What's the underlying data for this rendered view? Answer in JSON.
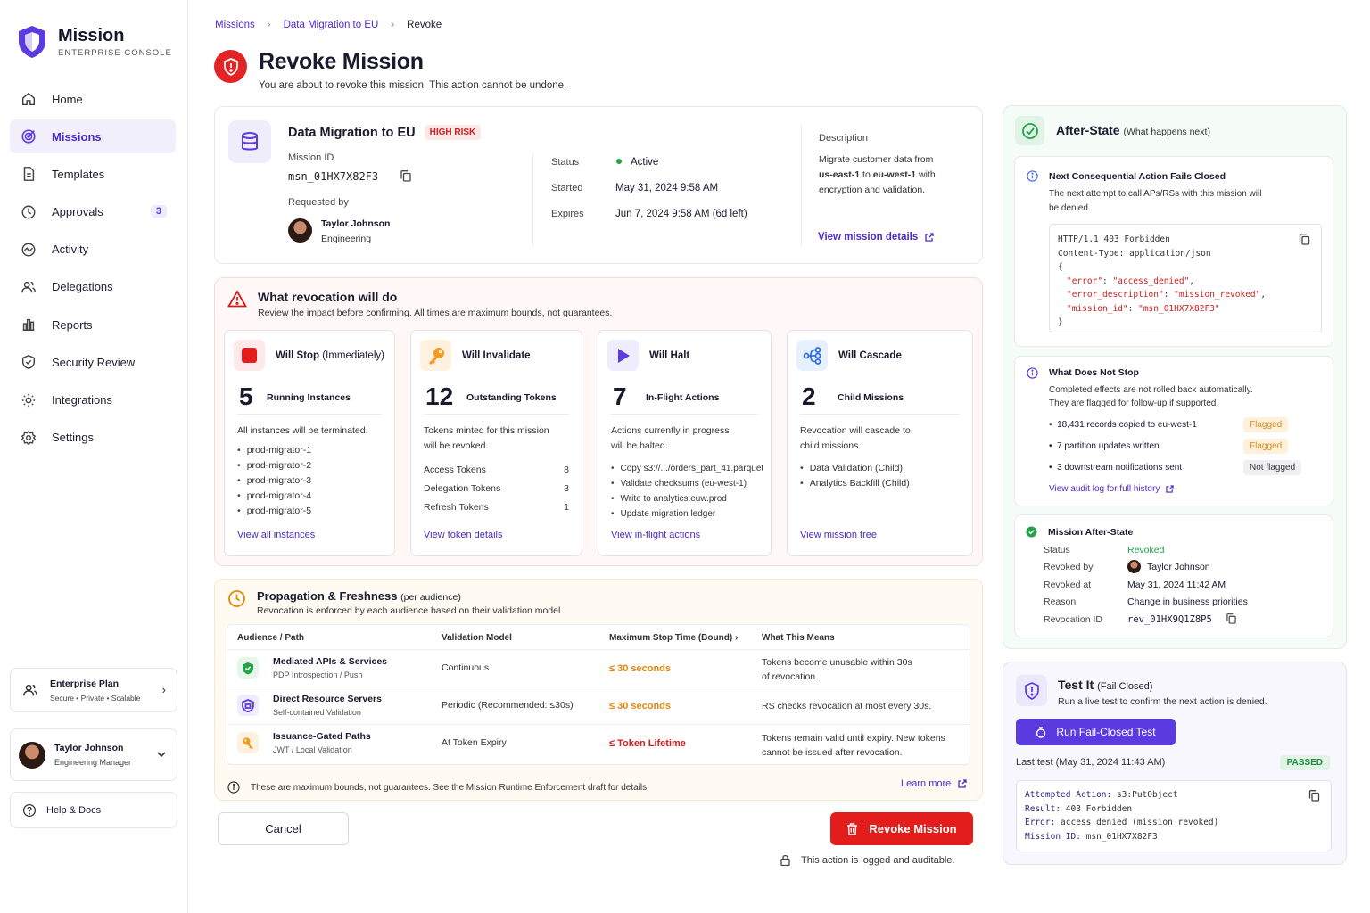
{
  "brand": {
    "name": "Mission",
    "subtitle": "ENTERPRISE CONSOLE"
  },
  "nav": [
    {
      "label": "Home",
      "icon": "home-icon"
    },
    {
      "label": "Missions",
      "icon": "target-icon",
      "active": true
    },
    {
      "label": "Templates",
      "icon": "document-icon"
    },
    {
      "label": "Approvals",
      "icon": "clock-icon",
      "badge": "3"
    },
    {
      "label": "Activity",
      "icon": "activity-icon"
    },
    {
      "label": "Delegations",
      "icon": "users-icon"
    },
    {
      "label": "Reports",
      "icon": "bar-chart-icon"
    },
    {
      "label": "Security Review",
      "icon": "shield-check-icon"
    },
    {
      "label": "Integrations",
      "icon": "cog-icon"
    },
    {
      "label": "Settings",
      "icon": "gear-icon"
    }
  ],
  "plan": {
    "title": "Enterprise Plan",
    "sub": "Secure • Private • Scalable"
  },
  "user": {
    "name": "Taylor Johnson",
    "role": "Engineering Manager"
  },
  "help": "Help & Docs",
  "breadcrumb": [
    "Missions",
    "Data Migration to EU",
    "Revoke"
  ],
  "page": {
    "title": "Revoke Mission",
    "subtitle": "You are about to revoke this mission. This action cannot be undone."
  },
  "mission": {
    "name": "Data Migration to EU",
    "risk": "HIGH RISK",
    "id_label": "Mission ID",
    "id": "msn_01HX7X82F3",
    "requested_by_label": "Requested by",
    "requester": "Taylor Johnson",
    "requester_team": "Engineering",
    "status_label": "Status",
    "status": "Active",
    "started_label": "Started",
    "started": "May 31, 2024 9:58 AM",
    "expires_label": "Expires",
    "expires": "Jun 7, 2024 9:58 AM (6d left)",
    "desc_label": "Description",
    "desc_1": "Migrate customer data from",
    "desc_2a": "us-east-1",
    "desc_2b": " to ",
    "desc_2c": "eu-west-1",
    "desc_2d": " with",
    "desc_3": "encryption and validation.",
    "details_link": "View mission details"
  },
  "impact": {
    "title": "What revocation will do",
    "subtitle": "Review the impact before confirming. All times are maximum bounds, not guarantees.",
    "stop": {
      "title": "Will Stop",
      "title_note": "(Immediately)",
      "count": "5",
      "count_label": "Running Instances",
      "desc": "All instances will be terminated.",
      "items": [
        "prod-migrator-1",
        "prod-migrator-2",
        "prod-migrator-3",
        "prod-migrator-4",
        "prod-migrator-5"
      ],
      "link": "View all instances"
    },
    "invalidate": {
      "title": "Will Invalidate",
      "count": "12",
      "count_label": "Outstanding Tokens",
      "desc_1": "Tokens minted for this mission",
      "desc_2": "will be revoked.",
      "rows": [
        {
          "k": "Access Tokens",
          "v": "8"
        },
        {
          "k": "Delegation Tokens",
          "v": "3"
        },
        {
          "k": "Refresh Tokens",
          "v": "1"
        }
      ],
      "link": "View token details"
    },
    "halt": {
      "title": "Will Halt",
      "count": "7",
      "count_label": "In-Flight Actions",
      "desc_1": "Actions currently in progress",
      "desc_2": "will be halted.",
      "items": [
        "Copy s3://.../orders_part_41.parquet",
        "Validate checksums (eu-west-1)",
        "Write to analytics.euw.prod",
        "Update migration ledger"
      ],
      "link": "View in-flight actions"
    },
    "cascade": {
      "title": "Will Cascade",
      "count": "2",
      "count_label": "Child Missions",
      "desc_1": "Revocation will cascade to",
      "desc_2": "child missions.",
      "items": [
        "Data Validation (Child)",
        "Analytics Backfill (Child)"
      ],
      "link": "View mission tree"
    }
  },
  "propagation": {
    "title": "Propagation & Freshness",
    "title_note": "(per audience)",
    "subtitle": "Revocation is enforced by each audience based on their validation model.",
    "columns": [
      "Audience / Path",
      "Validation Model",
      "Maximum Stop Time (Bound)",
      "What This Means"
    ],
    "rows": [
      {
        "name": "Mediated APIs & Services",
        "sub": "PDP Introspection / Push",
        "model": "Continuous",
        "time": "≤ 30 seconds",
        "meaning_1": "Tokens become unusable within 30s",
        "meaning_2": "of revocation."
      },
      {
        "name": "Direct Resource Servers",
        "sub": "Self-contained Validation",
        "model": "Periodic (Recommended: ≤30s)",
        "time": "≤ 30 seconds",
        "meaning_1": "RS checks revocation at most every 30s.",
        "meaning_2": ""
      },
      {
        "name": "Issuance-Gated Paths",
        "sub": "JWT / Local Validation",
        "model": "At Token Expiry",
        "time": "≤ Token Lifetime",
        "meaning_1": "Tokens remain valid until expiry. New tokens",
        "meaning_2": "cannot be issued after revocation."
      }
    ],
    "footnote": "These are maximum bounds, not guarantees. See the Mission Runtime Enforcement draft for details.",
    "learn_more": "Learn more"
  },
  "actions": {
    "cancel": "Cancel",
    "revoke": "Revoke Mission",
    "audit_note": "This action is logged and auditable."
  },
  "after": {
    "title": "After-State",
    "title_note": "(What happens next)",
    "fails": {
      "title": "Next Consequential Action Fails Closed",
      "desc_1": "The next attempt to call APs/RSs with this mission will",
      "desc_2": "be denied.",
      "code": {
        "l1": "HTTP/1.1 403 Forbidden",
        "l2": "Content-Type: application/json",
        "l3": "{",
        "k1": "\"error\"",
        "v1": "\"access_denied\"",
        "k2": "\"error_description\"",
        "v2": "\"mission_revoked\"",
        "k3": "\"mission_id\"",
        "v3": "\"msn_01HX7X82F3\"",
        "l7": "}"
      }
    },
    "nostop": {
      "title": "What Does Not Stop",
      "desc_1": "Completed effects are not rolled back automatically.",
      "desc_2": "They are flagged for follow-up if supported.",
      "items": [
        {
          "text": "18,431 records copied to eu-west-1",
          "tag": "Flagged"
        },
        {
          "text": "7 partition updates written",
          "tag": "Flagged"
        },
        {
          "text": "3 downstream notifications sent",
          "tag": "Not flagged"
        }
      ],
      "link": "View audit log for full history"
    },
    "state": {
      "title": "Mission After-State",
      "status_label": "Status",
      "status": "Revoked",
      "by_label": "Revoked by",
      "by": "Taylor Johnson",
      "at_label": "Revoked at",
      "at": "May 31, 2024 11:42 AM",
      "reason_label": "Reason",
      "reason": "Change in business priorities",
      "rid_label": "Revocation ID",
      "rid": "rev_01HX9Q1Z8P5"
    }
  },
  "test": {
    "title": "Test It",
    "title_note": "(Fail Closed)",
    "subtitle": "Run a live test to confirm the next action is denied.",
    "button": "Run Fail-Closed Test",
    "last": "Last test (May 31, 2024 11:43 AM)",
    "result": "PASSED",
    "out": [
      {
        "k": "Attempted Action:",
        "v": " s3:PutObject"
      },
      {
        "k": "Result:",
        "v": " 403 Forbidden"
      },
      {
        "k": "Error:",
        "v": " access_denied (mission_revoked)"
      },
      {
        "k": "Mission ID:",
        "v": " msn_01HX7X82F3"
      }
    ]
  },
  "colors": {
    "accent": "#5b3be0",
    "danger": "#e31c1c",
    "success": "#22a34a",
    "warning": "#e5870d"
  }
}
